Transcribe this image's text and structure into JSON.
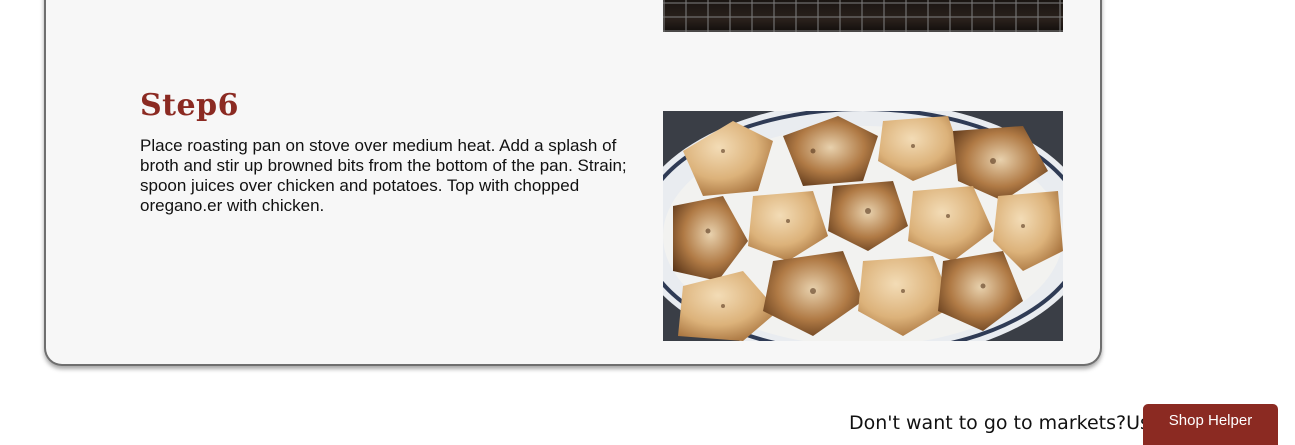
{
  "step": {
    "title": "Step6",
    "description": "Place roasting pan on stove over medium heat. Add a splash of broth and stir up browned bits from the bottom of the pan. Strain; spoon juices over chicken and potatoes. Top with chopped oregano.er with chicken."
  },
  "footer": {
    "prompt_text": "Don't want to go to markets?Use",
    "shop_helper_label": "Shop Helper"
  },
  "colors": {
    "accent": "#8b2a22",
    "card_background": "#f7f7f7",
    "card_border": "#6f6f6f"
  }
}
